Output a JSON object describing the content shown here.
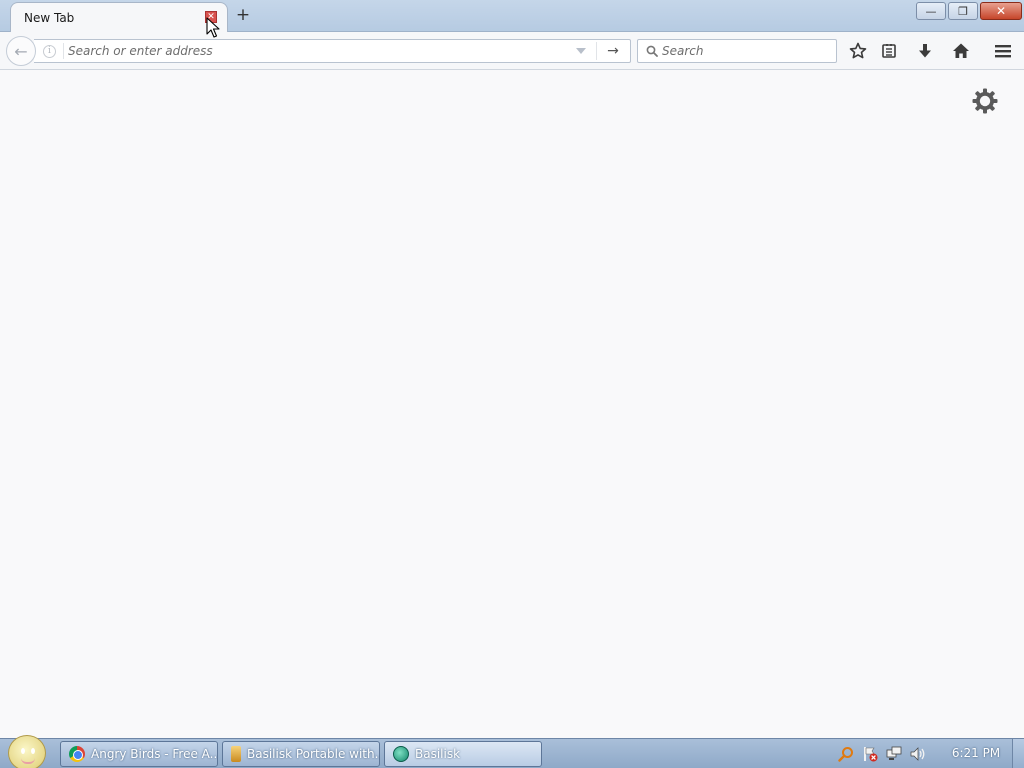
{
  "browser": {
    "tab": {
      "title": "New Tab",
      "close_glyph": "✕",
      "new_tab_glyph": "+"
    },
    "window_controls": {
      "minimize_glyph": "—",
      "restore_glyph": "❐",
      "close_glyph": "✕"
    },
    "urlbar": {
      "placeholder": "Search or enter address",
      "value": "",
      "info_glyph": "i",
      "go_glyph": "→"
    },
    "searchbar": {
      "placeholder": "Search",
      "value": ""
    },
    "back_glyph": "←",
    "toolbar_icons": [
      "star-icon",
      "reading-list-icon",
      "download-icon",
      "home-icon",
      "menu-icon"
    ],
    "content": {
      "settings_icon": "gear-icon"
    }
  },
  "taskbar": {
    "items": [
      {
        "label": "Angry Birds - Free A...",
        "icon": "chrome-icon"
      },
      {
        "label": "Basilisk Portable with...",
        "icon": "portable-app-icon"
      },
      {
        "label": "Basilisk",
        "icon": "basilisk-icon"
      }
    ],
    "tray_icons": [
      "search-tool-icon",
      "action-center-icon",
      "network-icon",
      "volume-icon"
    ],
    "clock": "6:21 PM"
  }
}
